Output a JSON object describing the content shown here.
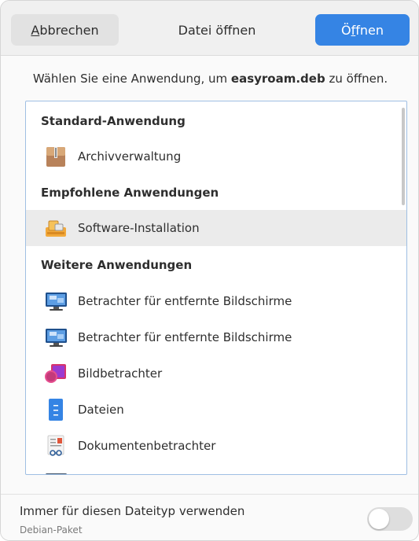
{
  "header": {
    "cancel_prefix": "",
    "cancel_mnemonic": "A",
    "cancel_rest": "bbrechen",
    "title": "Datei öffnen",
    "open_prefix": "Ö",
    "open_mnemonic": "f",
    "open_rest": "fnen"
  },
  "prompt": {
    "before": "Wählen Sie eine Anwendung, um ",
    "filename": "easyroam.deb",
    "after": " zu öffnen."
  },
  "list": {
    "section_default": "Standard-Anwendung",
    "section_recommended": "Empfohlene Anwendungen",
    "section_other": "Weitere Anwendungen",
    "items": [
      {
        "label": "Archivverwaltung",
        "icon": "archive-manager-icon"
      },
      {
        "label": "Software-Installation",
        "icon": "software-install-icon",
        "selected": true
      },
      {
        "label": "Betrachter für entfernte Bildschirme",
        "icon": "remote-viewer-icon"
      },
      {
        "label": "Betrachter für entfernte Bildschirme",
        "icon": "remote-viewer-icon"
      },
      {
        "label": "Bildbetrachter",
        "icon": "image-viewer-icon"
      },
      {
        "label": "Dateien",
        "icon": "files-icon"
      },
      {
        "label": "Dokumentenbetrachter",
        "icon": "document-viewer-icon"
      }
    ]
  },
  "footer": {
    "title": "Immer für diesen Dateityp verwenden",
    "subtitle": "Debian-Paket",
    "toggle_on": false
  },
  "colors": {
    "accent": "#3584e4",
    "selection": "#ebebeb"
  }
}
